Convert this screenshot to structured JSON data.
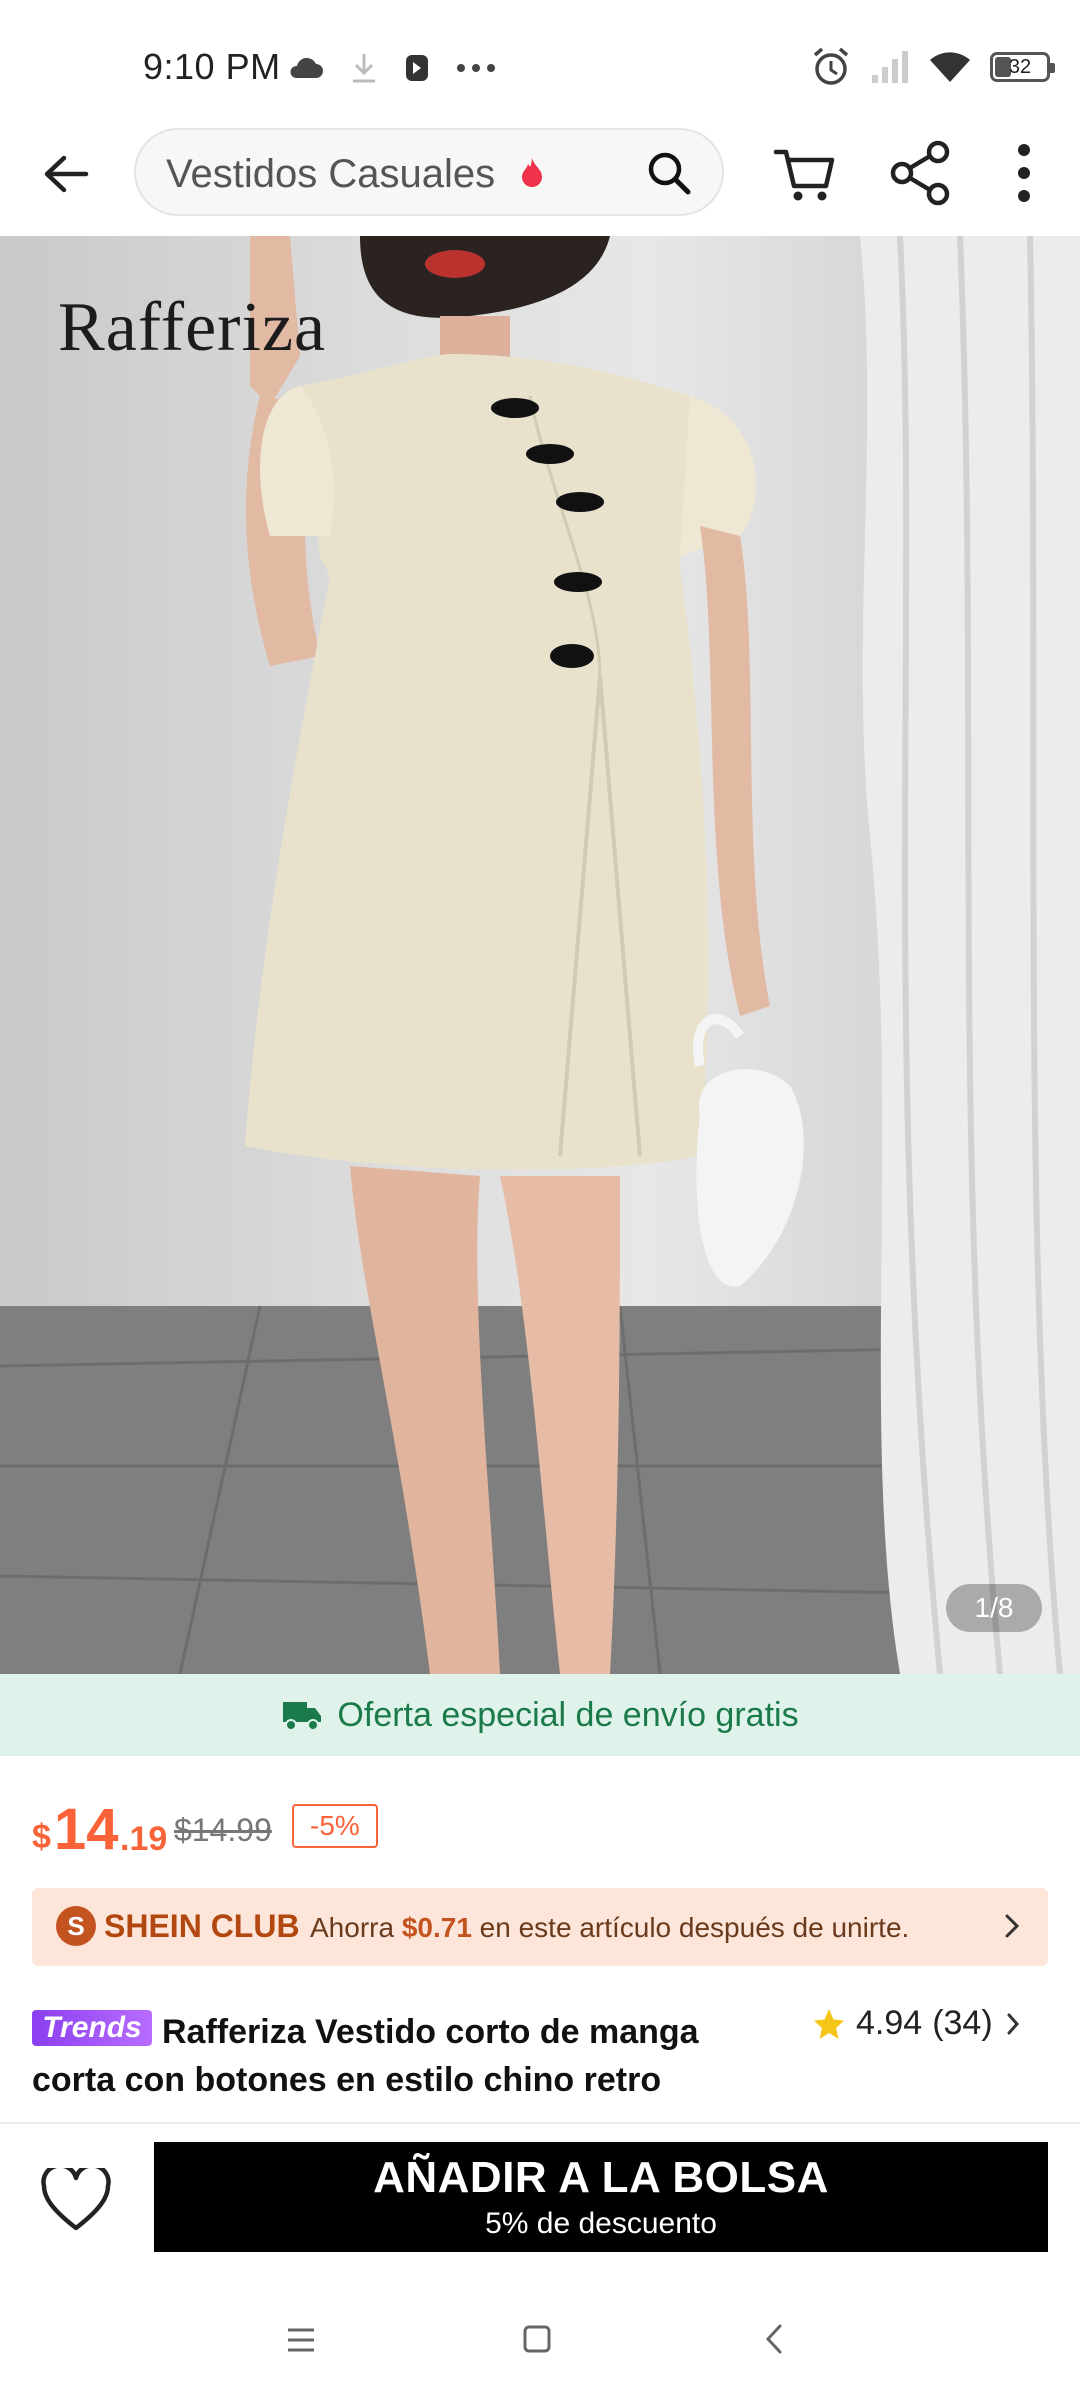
{
  "status_bar": {
    "time": "9:10 PM",
    "battery": "32",
    "icons": [
      "cloud-icon",
      "download-icon",
      "app-icon",
      "more-dots-icon",
      "alarm-icon",
      "signal-icon",
      "wifi-icon",
      "battery-icon"
    ]
  },
  "header": {
    "search_query": "Vestidos Casuales",
    "icons": [
      "back-arrow-icon",
      "flame-icon",
      "search-icon",
      "cart-icon",
      "share-icon",
      "more-vertical-icon"
    ]
  },
  "hero": {
    "brand_watermark": "Rafferiza",
    "image_counter": "1/8"
  },
  "shipping": {
    "text": "Oferta especial de envío gratis",
    "icon": "truck-icon"
  },
  "price": {
    "currency": "$",
    "integer": "14",
    "decimal": ".19",
    "original": "$14.99",
    "discount": "-5%"
  },
  "club": {
    "logo_letter": "S",
    "name": "SHEIN CLUB",
    "text_before": "Ahorra ",
    "amount": "$0.71",
    "text_after": " en este artículo después de unirte."
  },
  "product": {
    "badge": "Trends",
    "title": "Rafferiza Vestido corto de manga corta con botones en estilo chino retro",
    "rating": "4.94",
    "rating_count": "(34)"
  },
  "actions": {
    "add_to_bag": "AÑADIR A LA BOLSA",
    "add_to_bag_sub": "5% de descuento"
  },
  "colors": {
    "accent": "#fa6338",
    "shipping_bg": "#dff3ea",
    "shipping_text": "#1b7a4a",
    "club_bg": "#fde5da",
    "button_bg": "#000000",
    "trends": "#8a3ff0"
  }
}
